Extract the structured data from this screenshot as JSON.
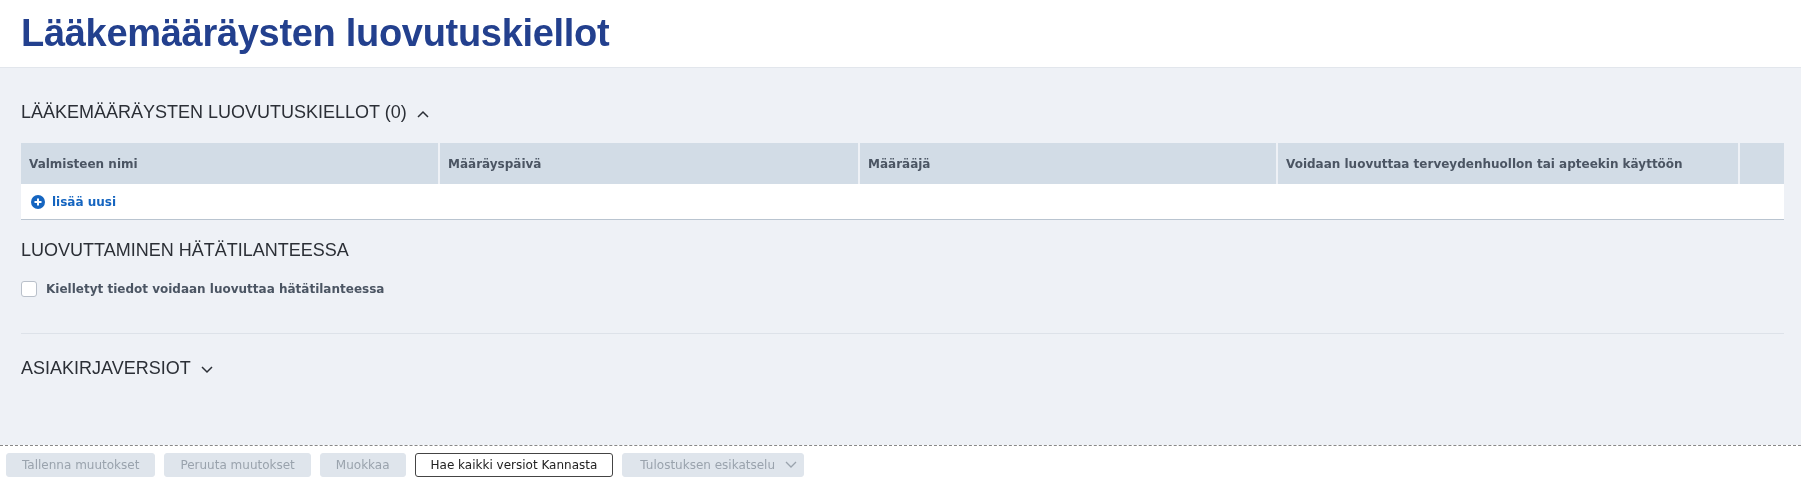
{
  "title": "Lääkemääräysten luovutuskiellot",
  "prohibitions": {
    "heading": "LÄÄKEMÄÄRÄYSTEN LUOVUTUSKIELLOT (0)",
    "expanded": true,
    "columns": [
      "Valmisteen nimi",
      "Määräyspäivä",
      "Määrääjä",
      "Voidaan luovuttaa terveydenhuollon tai apteekin käyttöön"
    ],
    "add_link": "lisää uusi"
  },
  "emergency": {
    "heading": "LUOVUTTAMINEN HÄTÄTILANTEESSA",
    "checkbox": {
      "label": "Kielletyt tiedot voidaan luovuttaa hätätilanteessa",
      "checked": false
    }
  },
  "versions": {
    "heading": "ASIAKIRJAVERSIOT",
    "expanded": false
  },
  "buttons": [
    {
      "label": "Tallenna muutokset",
      "disabled": true,
      "kind": "plain"
    },
    {
      "label": "Peruuta muutokset",
      "disabled": true,
      "kind": "plain"
    },
    {
      "label": "Muokkaa",
      "disabled": true,
      "kind": "plain"
    },
    {
      "label": "Hae kaikki versiot Kannasta",
      "disabled": false,
      "kind": "plain"
    },
    {
      "label": "Tulostuksen esikatselu",
      "disabled": true,
      "kind": "dropdown"
    }
  ]
}
